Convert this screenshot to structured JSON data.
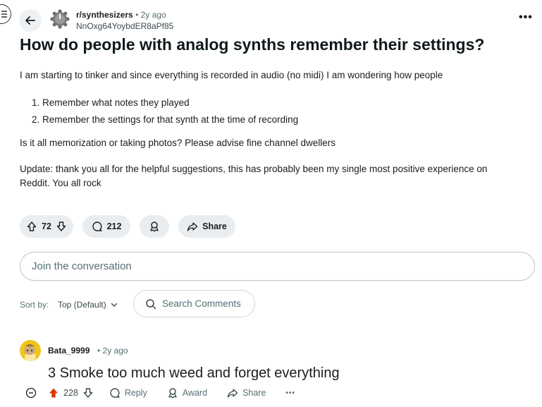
{
  "post": {
    "subreddit": "r/synthesizers",
    "separator": "•",
    "time": "2y ago",
    "author": "NnOxg64YoybdER8aPf85",
    "more": "•••",
    "title": "How do people with analog synths remember their settings?",
    "intro": "I am starting to tinker and since everything is recorded in audio (no midi) I am wondering how people",
    "list": [
      "Remember what notes they played",
      "Remember the settings for that synth at the time of recording"
    ],
    "question": "Is it all memorization or taking photos? Please advise fine channel dwellers",
    "update": "Update: thank you all for the helpful suggestions, this has probably been my single most positive experience on Reddit. You all rock"
  },
  "actions": {
    "votes": "72",
    "comments": "212",
    "share": "Share"
  },
  "join": {
    "placeholder": "Join the conversation"
  },
  "sort": {
    "label": "Sort by:",
    "value": "Top (Default)"
  },
  "search": {
    "placeholder": "Search Comments"
  },
  "comment": {
    "user": "Bata_9999",
    "separator": "•",
    "time": "2y ago",
    "text": "3 Smoke too much weed and forget everything",
    "votes": "228",
    "reply": "Reply",
    "award": "Award",
    "share": "Share",
    "more": "•••"
  },
  "colors": {
    "upvote": "#d93a00",
    "pill": "#eaedef",
    "muted": "#576f76"
  },
  "icons": [
    "menu-icon",
    "back-arrow-icon",
    "subreddit-knob-icon",
    "upvote-icon",
    "downvote-icon",
    "comment-icon",
    "award-icon",
    "share-icon",
    "search-icon",
    "chevron-down-icon",
    "collapse-icon"
  ]
}
